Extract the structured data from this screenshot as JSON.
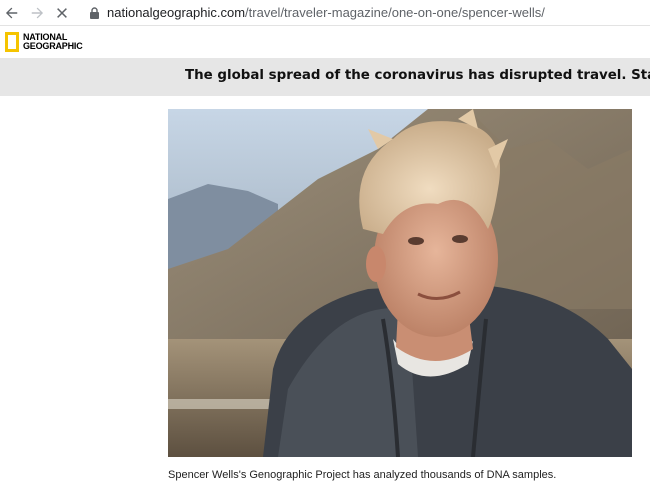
{
  "browser": {
    "url_host": "nationalgeographic.com",
    "url_path": "/travel/traveler-magazine/one-on-one/spencer-wells/",
    "icons": [
      "back-arrow-icon",
      "forward-arrow-icon",
      "stop-loading-icon",
      "lock-icon"
    ]
  },
  "header": {
    "logo_line1": "NATIONAL",
    "logo_line2": "GEOGRAPHIC",
    "logo_color": "#f5c400"
  },
  "alert": {
    "text": "The global spread of the coronavirus has disrupted travel. Stay up to date on t"
  },
  "article": {
    "image_alt": "Spencer Wells",
    "caption": "Spencer Wells's Genographic Project has analyzed thousands of DNA samples."
  }
}
